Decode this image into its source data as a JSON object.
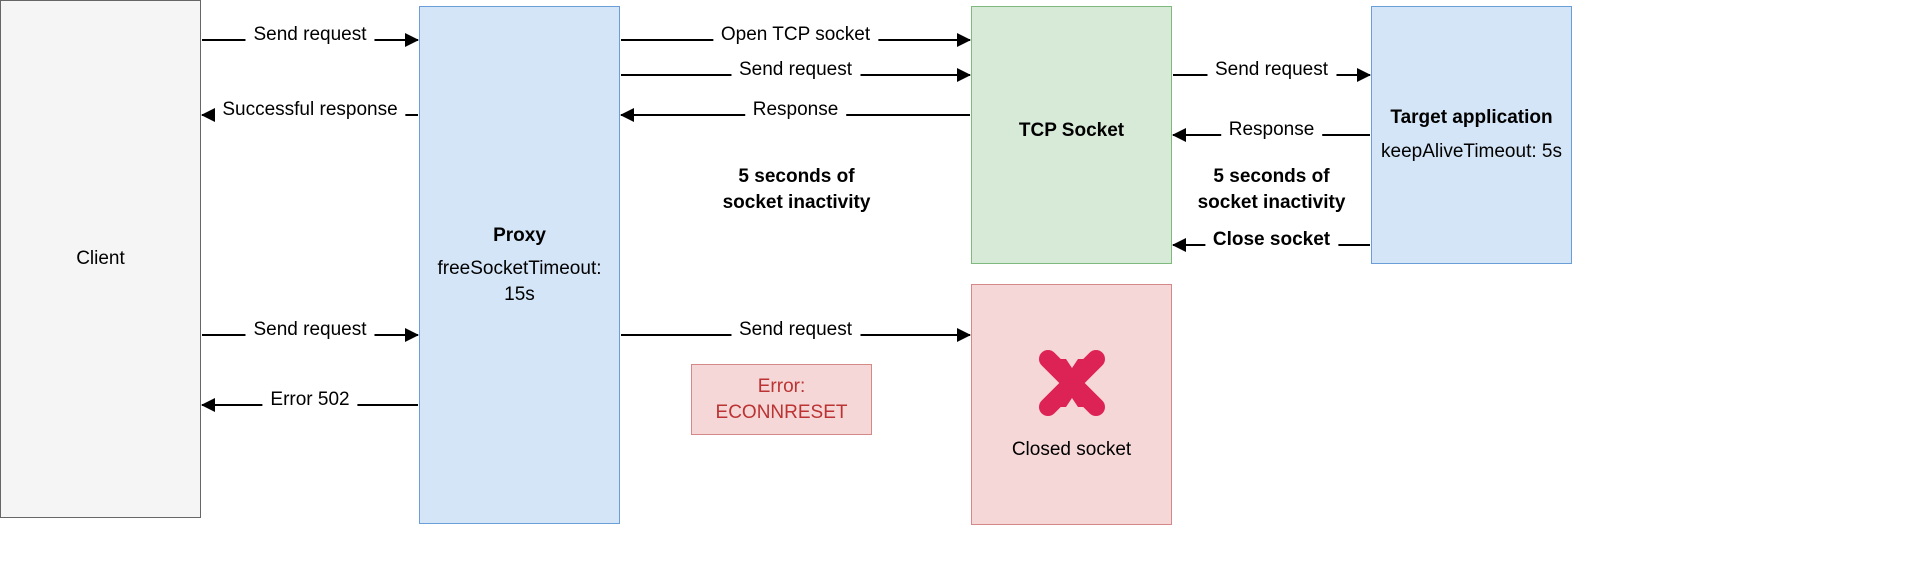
{
  "client": {
    "label": "Client"
  },
  "proxy": {
    "title": "Proxy",
    "subtitle": "freeSocketTimeout: 15s"
  },
  "tcp": {
    "title": "TCP Socket"
  },
  "closed": {
    "label": "Closed socket"
  },
  "target": {
    "title": "Target application",
    "subtitle": "keepAliveTimeout: 5s"
  },
  "error": {
    "line1": "Error:",
    "line2": "ECONNRESET"
  },
  "arrows": {
    "client_proxy_req1": "Send request",
    "proxy_client_resp": "Successful response",
    "client_proxy_req2": "Send request",
    "proxy_client_err": "Error 502",
    "proxy_tcp_open": "Open TCP socket",
    "proxy_tcp_req": "Send request",
    "tcp_proxy_resp": "Response",
    "proxy_closed_req": "Send request",
    "tcp_target_req": "Send request",
    "target_tcp_resp": "Response",
    "target_tcp_close": "Close socket"
  },
  "notes": {
    "idle1_l1": "5 seconds of",
    "idle1_l2": "socket inactivity",
    "idle2_l1": "5 seconds of",
    "idle2_l2": "socket inactivity"
  }
}
